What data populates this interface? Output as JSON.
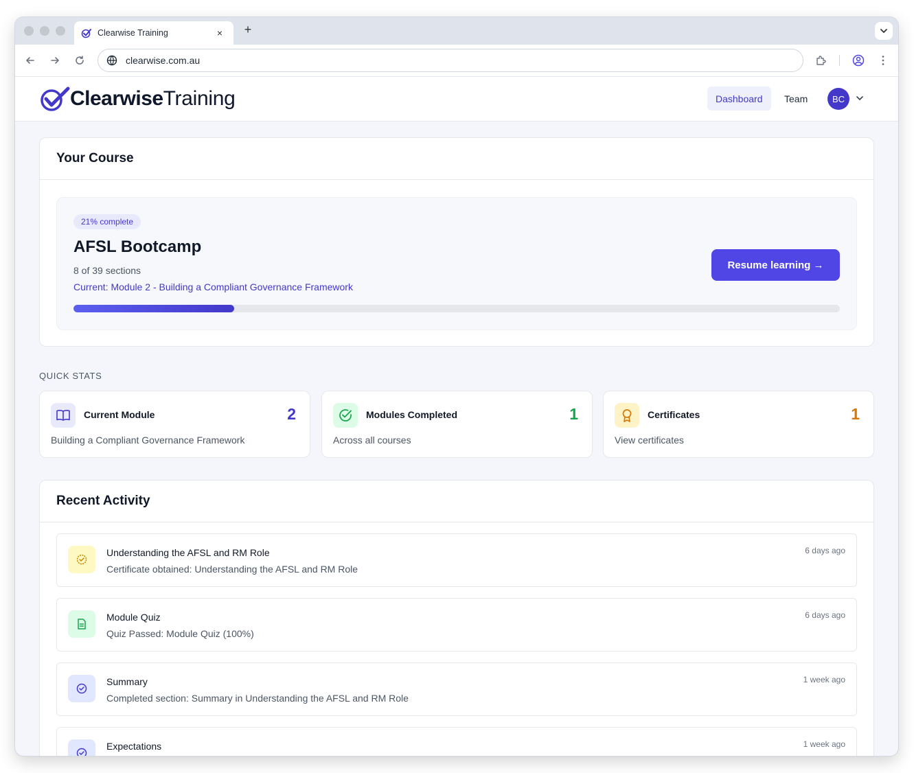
{
  "browser": {
    "tab_title": "Clearwise Training",
    "tab_close": "×",
    "new_tab": "+",
    "url": "clearwise.com.au"
  },
  "header": {
    "logo_bold": "Clearwise",
    "logo_light": "Training",
    "nav": {
      "dashboard": "Dashboard",
      "team": "Team"
    },
    "avatar_initials": "BC"
  },
  "course": {
    "heading": "Your Course",
    "pill": "21% complete",
    "progress_fraction": 0.21,
    "title": "AFSL Bootcamp",
    "sections": "8 of 39 sections",
    "current": "Current: Module 2 - Building a Compliant Governance Framework",
    "resume_label": "Resume learning →"
  },
  "quick_stats": {
    "label": "QUICK STATS",
    "cards": [
      {
        "title": "Current Module",
        "value": "2",
        "sub": "Building a Compliant Governance Framework",
        "icon": "book-open-icon",
        "color": "#4338ca",
        "icon_bg": "#e8eafb"
      },
      {
        "title": "Modules Completed",
        "value": "1",
        "sub": "Across all courses",
        "icon": "check-circle-icon",
        "color": "#16a34a",
        "icon_bg": "#dcfce7"
      },
      {
        "title": "Certificates",
        "value": "1",
        "sub": "View certificates",
        "icon": "award-icon",
        "color": "#d97706",
        "icon_bg": "#fef3c7"
      }
    ]
  },
  "activity": {
    "heading": "Recent Activity",
    "items": [
      {
        "title": "Understanding the AFSL and RM Role",
        "sub": "Certificate obtained: Understanding the AFSL and RM Role",
        "time": "6 days ago",
        "icon": "badge-check-icon",
        "color": "#ca8a04",
        "icon_bg": "#fef9c3"
      },
      {
        "title": "Module Quiz",
        "sub": "Quiz Passed: Module Quiz (100%)",
        "time": "6 days ago",
        "icon": "document-icon",
        "color": "#16a34a",
        "icon_bg": "#dcfce7"
      },
      {
        "title": "Summary",
        "sub": "Completed section: Summary in Understanding the AFSL and RM Role",
        "time": "1 week ago",
        "icon": "check-circle-icon",
        "color": "#4338ca",
        "icon_bg": "#e0e7ff"
      },
      {
        "title": "Expectations",
        "sub": "",
        "time": "1 week ago",
        "icon": "check-circle-icon",
        "color": "#4338ca",
        "icon_bg": "#e0e7ff"
      }
    ]
  }
}
